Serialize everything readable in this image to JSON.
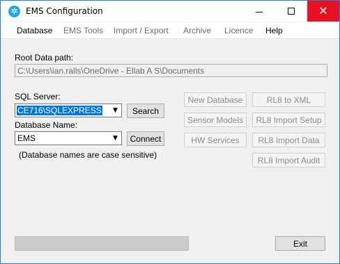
{
  "window": {
    "title": "EMS Configuration"
  },
  "menu": [
    "Database",
    "EMS Tools",
    "Import / Export",
    "Archive",
    "Licence",
    "Help"
  ],
  "root_path": {
    "label": "Root Data path:",
    "value": "C:\\Users\\ian.ralls\\OneDrive - Ellab A S\\Documents"
  },
  "sql": {
    "label": "SQL Server:",
    "value": "CE716\\SQLEXPRESS",
    "search_label": "Search"
  },
  "database": {
    "label": "Database Name:",
    "value": "EMS",
    "connect_label": "Connect",
    "note": "(Database names are case sensitive)"
  },
  "actions": {
    "new_database": "New Database",
    "sensor_models": "Sensor Models",
    "hw_services": "HW Services",
    "rl8_to_xml": "RL8 to XML",
    "rl8_import_setup": "RL8 Import Setup",
    "rl8_import_data": "RL8 Import Data",
    "rl8_import_audit": "RL8 Import Audit"
  },
  "progress": {
    "value": 0
  },
  "exit_label": "Exit",
  "colors": {
    "accent": "#0078d7",
    "close": "#e81123",
    "border": "#1883d7"
  }
}
